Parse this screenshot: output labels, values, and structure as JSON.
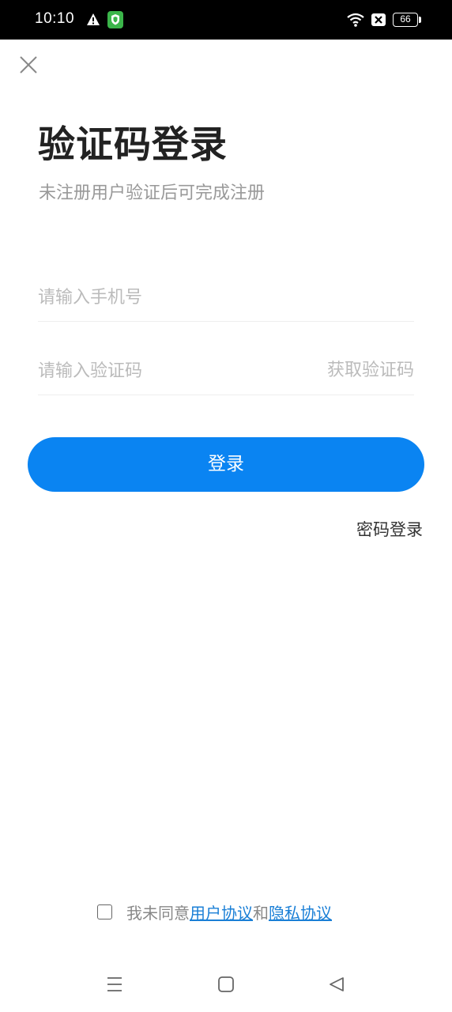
{
  "status_bar": {
    "time": "10:10",
    "battery": "66",
    "icons": [
      "warning-icon",
      "shield-icon",
      "wifi-icon",
      "no-sim-icon",
      "battery-icon"
    ]
  },
  "header": {
    "close_icon": "close-icon",
    "title": "验证码登录",
    "subtitle": "未注册用户验证后可完成注册"
  },
  "form": {
    "phone_placeholder": "请输入手机号",
    "code_placeholder": "请输入验证码",
    "get_code_label": "获取验证码",
    "login_label": "登录",
    "password_login_label": "密码登录"
  },
  "agreement": {
    "prefix": "我未同意",
    "user_agreement": "用户协议",
    "conjunction": "和",
    "privacy_policy": "隐私协议"
  },
  "nav_bar": {
    "icons": [
      "menu-icon",
      "home-icon",
      "back-icon"
    ]
  },
  "colors": {
    "primary": "#0a84f2",
    "link": "#1a7fd6",
    "placeholder": "#bbbbbb",
    "subtitle": "#999999"
  }
}
